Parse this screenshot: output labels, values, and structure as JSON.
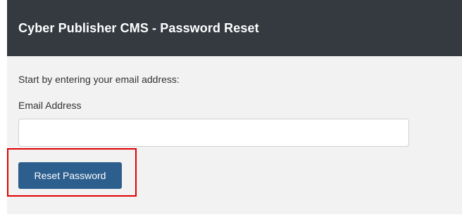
{
  "header": {
    "title": "Cyber Publisher CMS - Password Reset"
  },
  "form": {
    "intro_text": "Start by entering your email address:",
    "email_label": "Email Address",
    "email_value": "",
    "email_placeholder": "",
    "submit_label": "Reset Password"
  },
  "colors": {
    "header_background": "#343a40",
    "panel_background": "#f2f2f2",
    "button_background": "#2c5e8e",
    "highlight_border": "#e00000"
  }
}
